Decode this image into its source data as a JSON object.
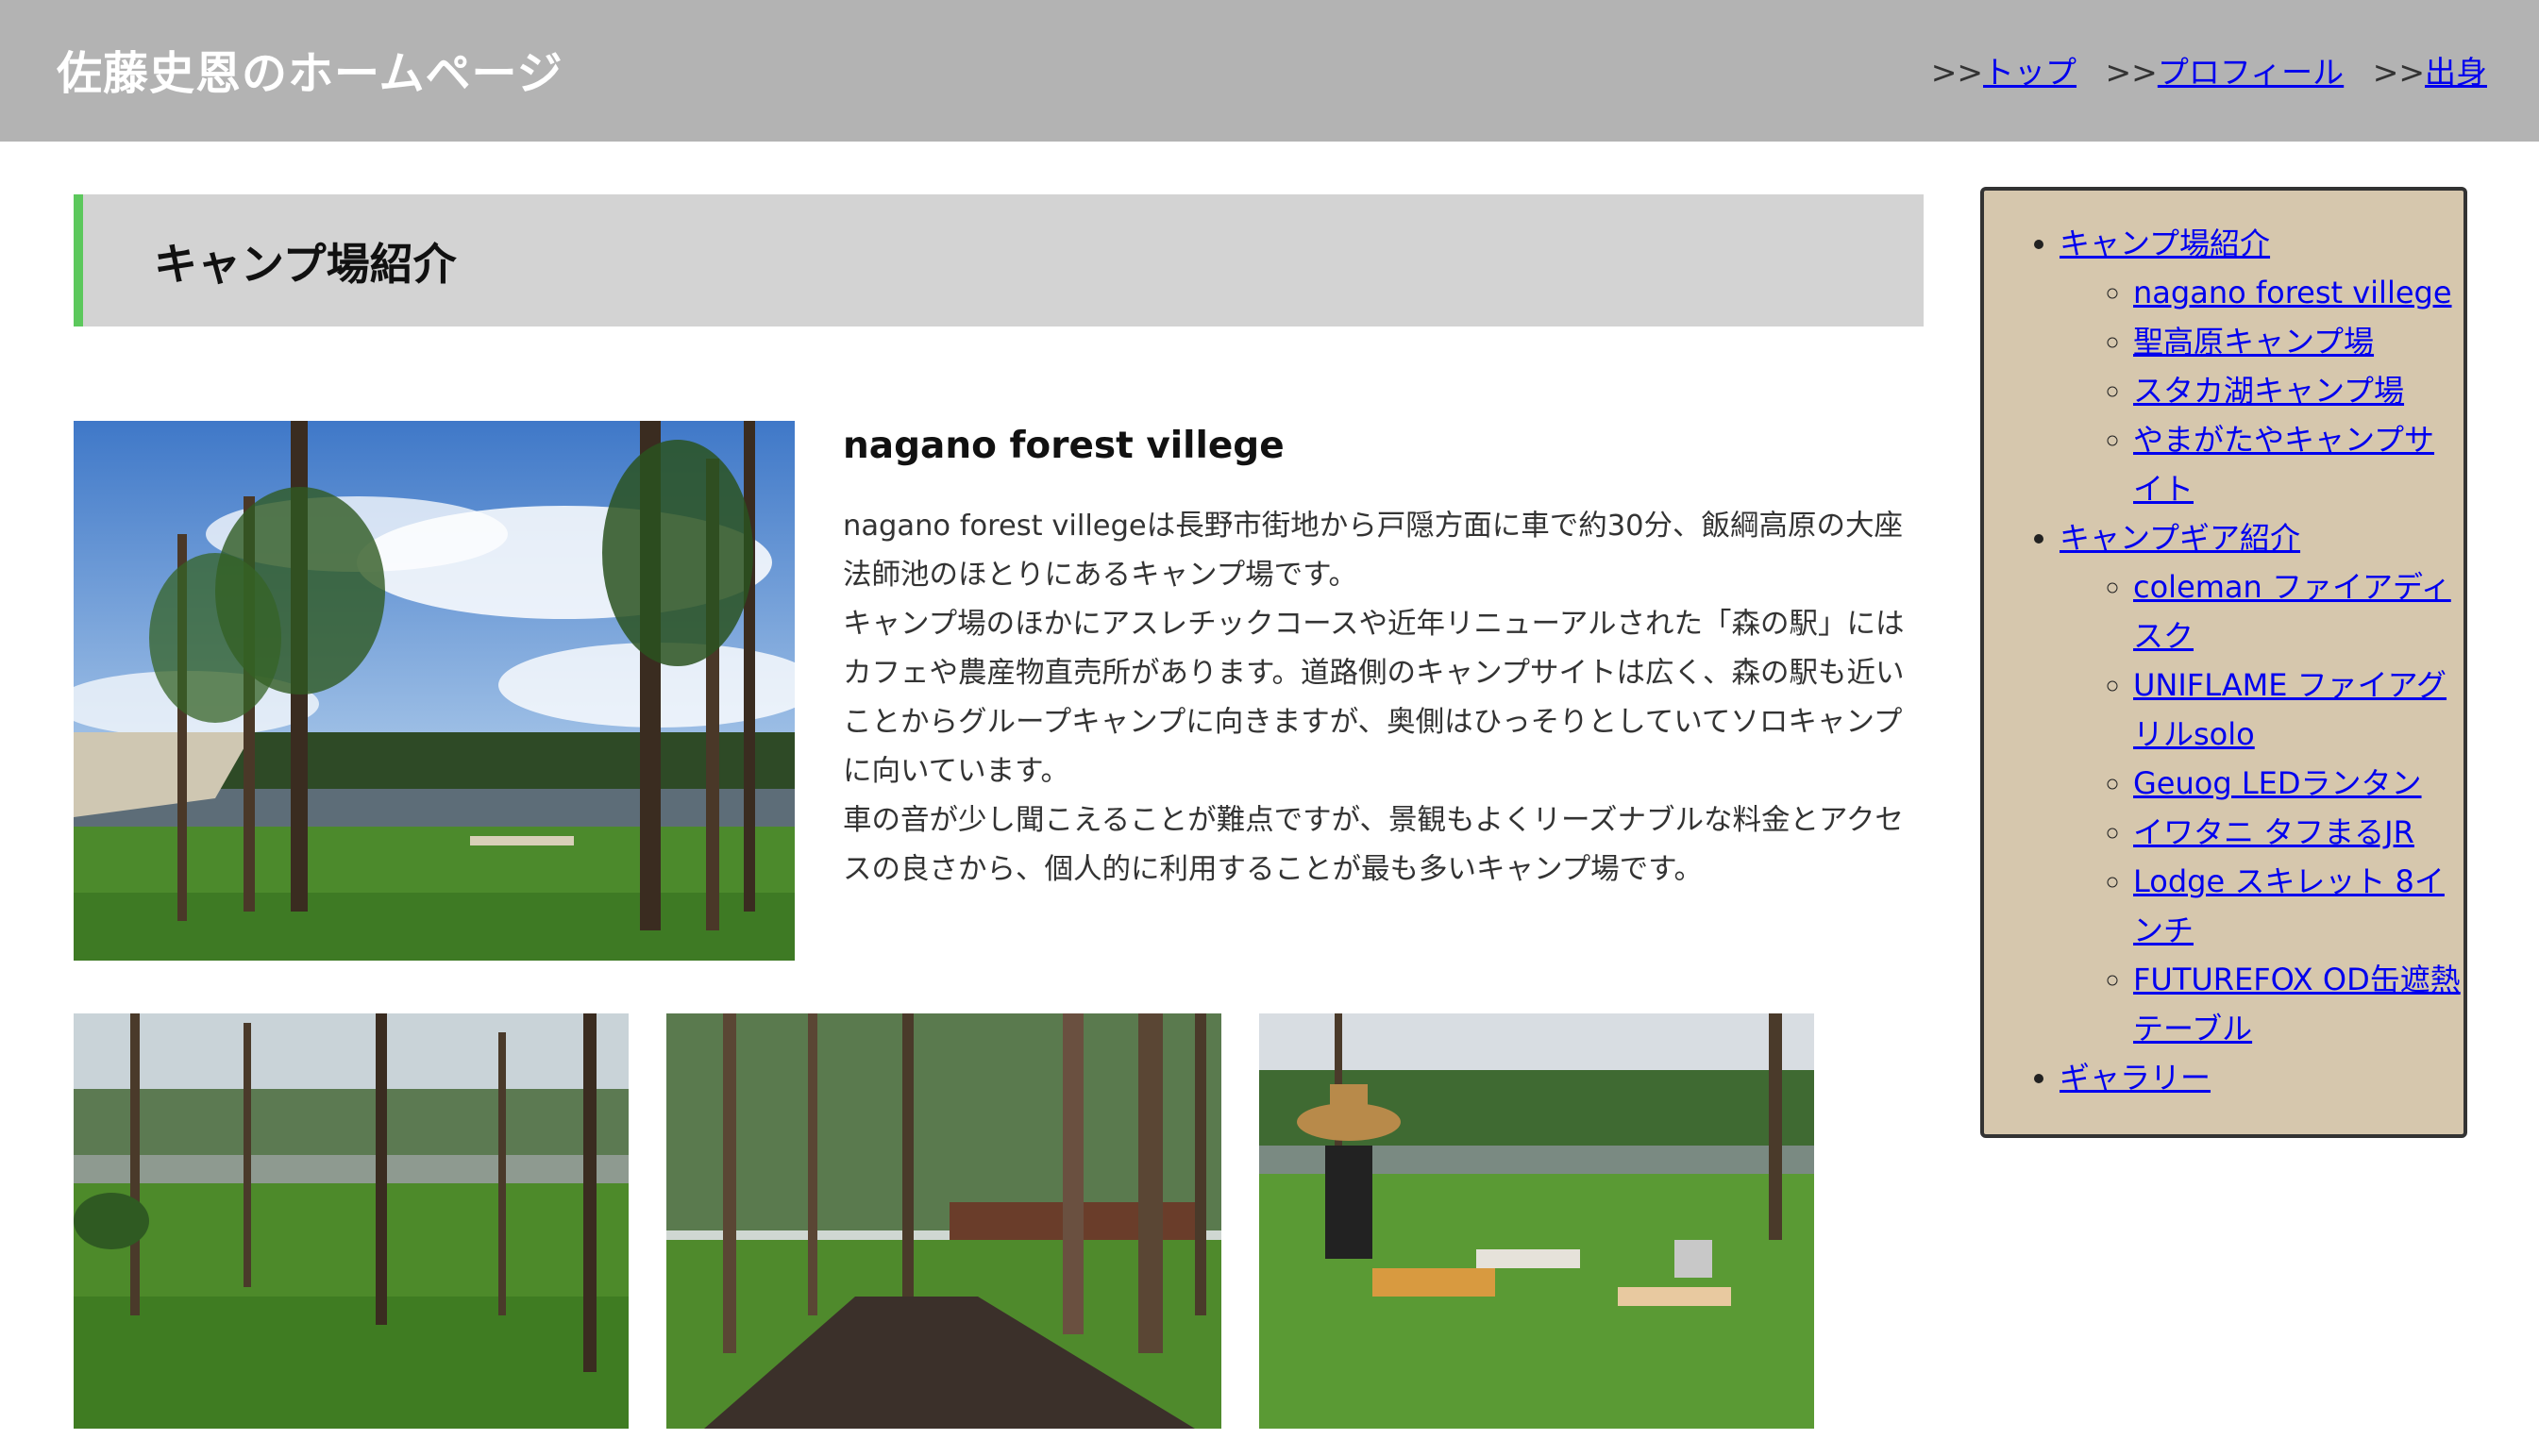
{
  "header": {
    "site_title": "佐藤史恩のホームページ",
    "nav": [
      {
        "prefix": ">>",
        "label": "トップ"
      },
      {
        "prefix": ">>",
        "label": "プロフィール"
      },
      {
        "prefix": ">>",
        "label": "出身"
      }
    ]
  },
  "section": {
    "title": "キャンプ場紹介"
  },
  "camp": {
    "title": "nagano forest villege",
    "paragraphs": [
      "nagano forest villegeは長野市街地から戸隠方面に車で約30分、飯綱高原の大座法師池のほとりにあるキャンプ場です。",
      "キャンプ場のほかにアスレチックコースや近年リニューアルされた「森の駅」にはカフェや農産物直売所があります。道路側のキャンプサイトは広く、森の駅も近いことからグループキャンプに向きますが、奥側はひっそりとしていてソロキャンプに向いています。",
      "車の音が少し聞こえることが難点ですが、景観もよくリーズナブルな料金とアクセスの良さから、個人的に利用することが最も多いキャンプ場です。"
    ]
  },
  "sidebar": {
    "items": [
      {
        "label": "キャンプ場紹介",
        "children": [
          {
            "label": "nagano forest villege"
          },
          {
            "label": "聖高原キャンプ場"
          },
          {
            "label": "スタカ湖キャンプ場"
          },
          {
            "label": "やまがたやキャンプサイト"
          }
        ]
      },
      {
        "label": "キャンプギア紹介",
        "children": [
          {
            "label": "coleman ファイアディスク"
          },
          {
            "label": "UNIFLAME ファイアグリルsolo"
          },
          {
            "label": "Geuog LEDランタン"
          },
          {
            "label": "イワタニ タフまるJR"
          },
          {
            "label": "Lodge スキレット 8インチ"
          },
          {
            "label": "FUTUREFOX OD缶遮熱テーブル"
          }
        ]
      },
      {
        "label": "ギャラリー",
        "children": []
      }
    ]
  },
  "colors": {
    "header_bg": "#b3b3b3",
    "section_bg": "#d3d3d3",
    "section_accent": "#5cc85c",
    "sidebar_bg": "#d6c7ad",
    "link": "#0000ee"
  }
}
